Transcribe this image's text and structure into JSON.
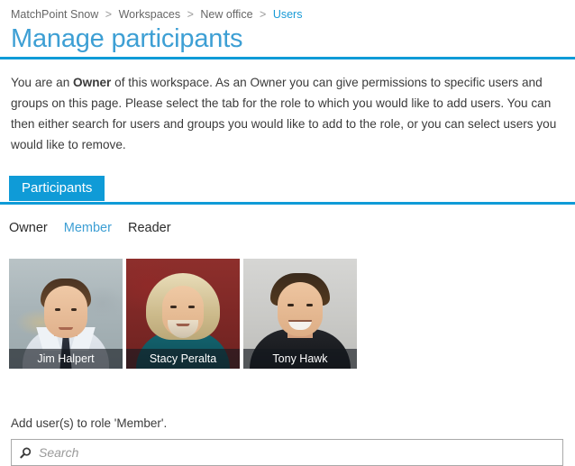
{
  "breadcrumb": {
    "separator": ">",
    "items": [
      {
        "label": "MatchPoint Snow",
        "is_link": false
      },
      {
        "label": "Workspaces",
        "is_link": false
      },
      {
        "label": "New office",
        "is_link": false
      },
      {
        "label": "Users",
        "is_link": true
      }
    ]
  },
  "page": {
    "title": "Manage participants",
    "intro_part1": "You are an ",
    "intro_bold": "Owner",
    "intro_part2": " of this workspace. As an Owner you can give permissions to specific users and groups on this page. Please select the tab for the role to which you would like to add users. You can then either search for users and groups you would like to add to the role, or you can select users you would like to remove."
  },
  "tabs": [
    {
      "label": "Participants",
      "active": true
    }
  ],
  "roles": [
    {
      "label": "Owner",
      "active": false
    },
    {
      "label": "Member",
      "active": true
    },
    {
      "label": "Reader",
      "active": false
    }
  ],
  "participants": [
    {
      "name": "Jim Halpert"
    },
    {
      "name": "Stacy Peralta"
    },
    {
      "name": "Tony Hawk"
    }
  ],
  "add_user": {
    "label": "Add user(s) to role 'Member'.",
    "search_placeholder": "Search",
    "search_value": "",
    "search_icon": "search-icon"
  },
  "colors": {
    "accent": "#0f9bd7",
    "title": "#3d9fd4",
    "text": "#3b3b3b",
    "breadcrumb": "#666666",
    "border": "#a9a9a9"
  }
}
